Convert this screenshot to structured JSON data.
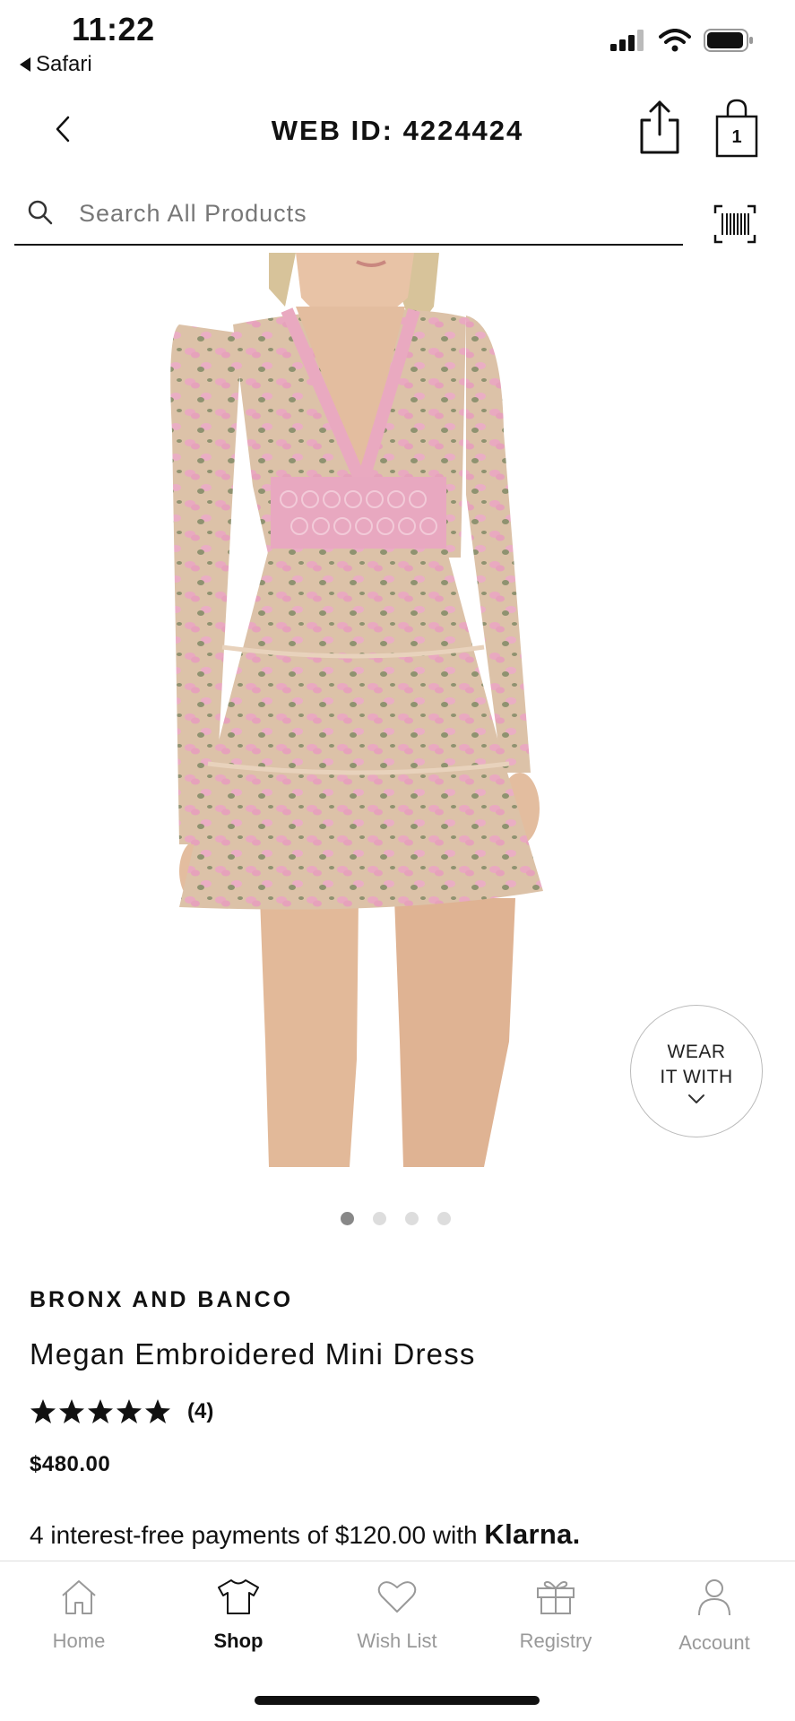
{
  "status_bar": {
    "time": "11:22",
    "back_app": "Safari",
    "icons": [
      "signal-icon",
      "wifi-icon",
      "battery-icon"
    ]
  },
  "header": {
    "title": "WEB ID: 4224424",
    "cart_count": "1",
    "icons": [
      "back-chevron-icon",
      "share-icon",
      "shopping-bag-icon"
    ]
  },
  "search": {
    "placeholder": "Search All Products",
    "icons": [
      "search-icon",
      "barcode-scan-icon"
    ]
  },
  "gallery": {
    "image": "Model wearing pink floral embroidered long-sleeve mini dress",
    "dots_total": 4,
    "active_index": 0,
    "wear_with": {
      "line1": "WEAR",
      "line2": "IT WITH"
    }
  },
  "product": {
    "brand": "BRONX AND BANCO",
    "name": "Megan Embroidered Mini Dress",
    "rating_stars": 5,
    "review_count": "(4)",
    "price": "$480.00",
    "installments_text": "4 interest-free payments of $120.00 with ",
    "installments_provider": "Klarna."
  },
  "tab_bar": {
    "active": "shop",
    "tabs": [
      {
        "id": "home",
        "label": "Home",
        "icon": "home-icon"
      },
      {
        "id": "shop",
        "label": "Shop",
        "icon": "shirt-icon"
      },
      {
        "id": "wishlist",
        "label": "Wish List",
        "icon": "heart-icon"
      },
      {
        "id": "registry",
        "label": "Registry",
        "icon": "gift-icon"
      },
      {
        "id": "account",
        "label": "Account",
        "icon": "person-icon"
      }
    ]
  },
  "colors": {
    "text": "#111111",
    "muted": "#999999",
    "dress_pink": "#e9a9c0",
    "dress_tulle": "#dcc2a8",
    "skin": "#e3bd9f"
  }
}
